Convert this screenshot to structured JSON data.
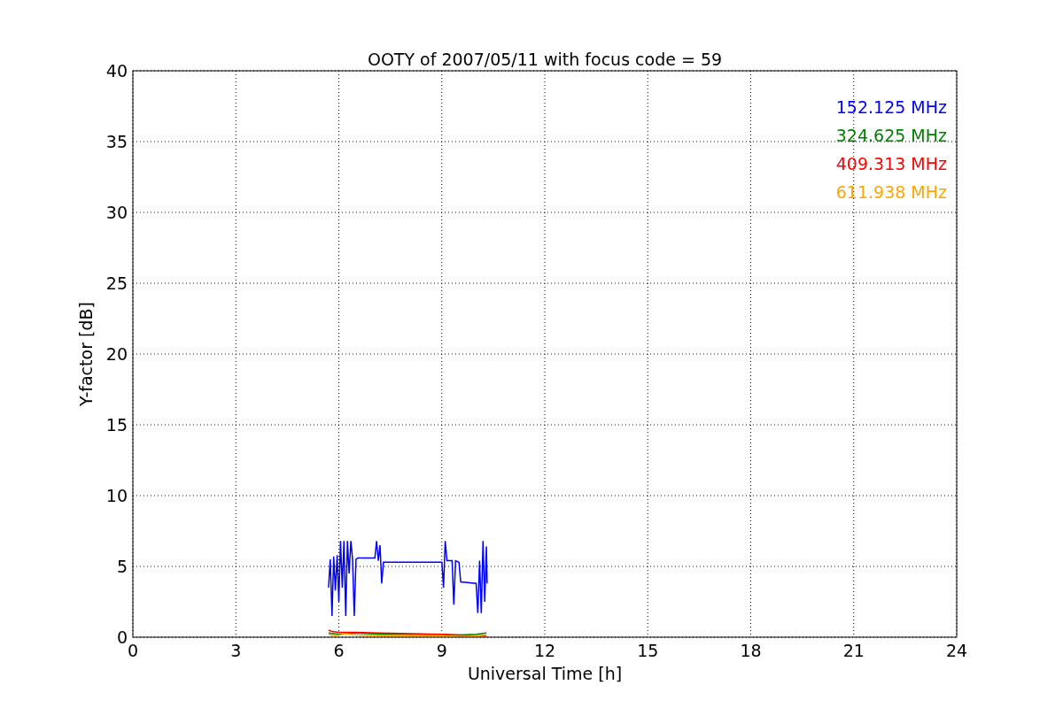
{
  "chart_data": {
    "type": "line",
    "title": "OOTY of 2007/05/11 with focus code = 59",
    "xlabel": "Universal Time [h]",
    "ylabel": "Y-factor [dB]",
    "xlim": [
      0,
      24
    ],
    "ylim": [
      0,
      40
    ],
    "xticks": [
      0,
      3,
      6,
      9,
      12,
      15,
      18,
      21,
      24
    ],
    "yticks": [
      0,
      5,
      10,
      15,
      20,
      25,
      30,
      35,
      40
    ],
    "grid": true,
    "series": [
      {
        "name": "152.125 MHz",
        "color": "#0000ff",
        "x": [
          5.7,
          5.75,
          5.8,
          5.85,
          5.9,
          5.95,
          6.0,
          6.05,
          6.1,
          6.15,
          6.2,
          6.25,
          6.3,
          6.35,
          6.4,
          6.45,
          6.5,
          6.55,
          7.05,
          7.1,
          7.15,
          7.2,
          7.25,
          7.3,
          9.0,
          9.05,
          9.1,
          9.15,
          9.3,
          9.35,
          9.4,
          9.5,
          9.55,
          10.0,
          10.05,
          10.1,
          10.15,
          10.2,
          10.25,
          10.3,
          10.32
        ],
        "values": [
          3.5,
          5.5,
          1.5,
          5.7,
          3.3,
          5.8,
          2.5,
          6.8,
          3.5,
          6.8,
          1.5,
          6.8,
          4.5,
          6.8,
          5.5,
          1.5,
          5.5,
          5.6,
          5.6,
          6.8,
          5.4,
          6.5,
          3.8,
          5.3,
          5.3,
          3.5,
          6.8,
          5.4,
          5.4,
          2.3,
          5.4,
          5.3,
          3.9,
          3.8,
          1.7,
          5.4,
          1.7,
          6.8,
          2.5,
          6.4,
          3.8
        ]
      },
      {
        "name": "324.625 MHz",
        "color": "#008000",
        "x": [
          5.7,
          6.0,
          6.5,
          7.2,
          9.0,
          9.5,
          10.0,
          10.3
        ],
        "values": [
          0.3,
          0.2,
          0.3,
          0.2,
          0.2,
          0.15,
          0.2,
          0.3
        ]
      },
      {
        "name": "409.313 MHz",
        "color": "#ff0000",
        "x": [
          5.7,
          5.8,
          6.0,
          6.5,
          7.2,
          9.0,
          9.5,
          10.0,
          10.3
        ],
        "values": [
          0.5,
          0.4,
          0.35,
          0.35,
          0.3,
          0.2,
          0.15,
          0.1,
          0.1
        ]
      },
      {
        "name": "611.938 MHz",
        "color": "#ffa500",
        "x": [
          5.7,
          5.9,
          6.2,
          6.5,
          7.2,
          9.0,
          9.5,
          10.0,
          10.3
        ],
        "values": [
          0.2,
          0.1,
          0.25,
          0.15,
          0.1,
          0.1,
          0.05,
          0.1,
          0.15
        ]
      }
    ]
  }
}
